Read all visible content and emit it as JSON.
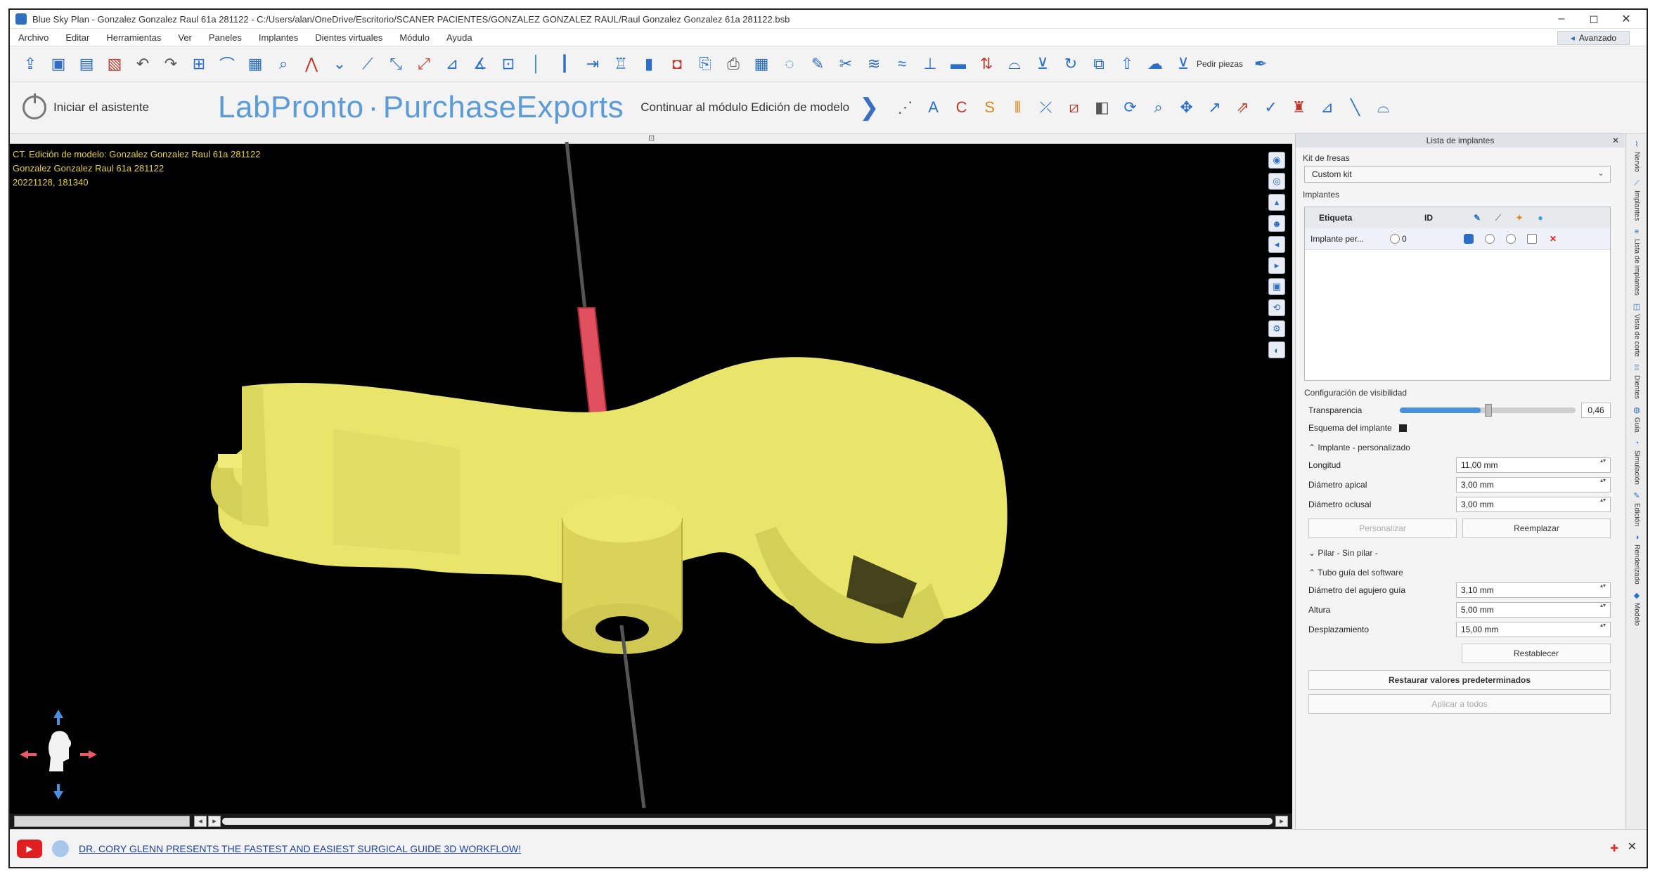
{
  "window": {
    "title": "Blue Sky Plan - Gonzalez Gonzalez Raul 61a 281122 - C:/Users/alan/OneDrive/Escritorio/SCANER PACIENTES/GONZALEZ GONZALEZ RAUL/Raul Gonzalez Gonzalez 61a 281122.bsb",
    "minimize": "–",
    "maximize": "◻",
    "close": "✕"
  },
  "menu": {
    "items": [
      "Archivo",
      "Editar",
      "Herramientas",
      "Ver",
      "Paneles",
      "Implantes",
      "Dientes virtuales",
      "Módulo",
      "Ayuda"
    ],
    "advanced": "Avanzado"
  },
  "toolbar1": {
    "order_label": "Pedir piezas"
  },
  "toolbar2": {
    "wizard": "Iniciar el asistente",
    "brand_lab": "LabPronto",
    "brand_purchase": "PurchaseExports",
    "continue": "Continuar al módulo Edición de modelo"
  },
  "viewport": {
    "line1": "CT. Edición de modelo: Gonzalez Gonzalez Raul 61a 281122",
    "line2": "Gonzalez Gonzalez Raul 61a 281122",
    "line3": "20221128, 181340",
    "colors": {
      "guide": "#e8e56a",
      "sleeve": "#d9d35a",
      "implant": "#e0505f",
      "background": "#000000"
    }
  },
  "panel": {
    "title": "Lista de implantes",
    "kit_label": "Kit de fresas",
    "kit_value": "Custom kit",
    "implants_label": "Implantes",
    "table_headers": {
      "label": "Etiqueta",
      "id": "ID"
    },
    "implant_row": {
      "label": "Implante per...",
      "id": "0"
    },
    "visibility_label": "Configuración de visibilidad",
    "transparency_label": "Transparencia",
    "transparency_value": "0,46",
    "transparency_fraction": 0.46,
    "outline_label": "Esquema del implante",
    "implant_group": "Implante - personalizado",
    "length_label": "Longitud",
    "length_value": "11,00 mm",
    "apical_label": "Diámetro apical",
    "apical_value": "3,00 mm",
    "occlusal_label": "Diámetro oclusal",
    "occlusal_value": "3,00 mm",
    "personalize_btn": "Personalizar",
    "replace_btn": "Reemplazar",
    "pilar_group": "Pilar - Sin pilar -",
    "tube_group": "Tubo guía del software",
    "hole_label": "Diámetro del agujero guía",
    "hole_value": "3,10 mm",
    "height_label": "Altura",
    "height_value": "5,00 mm",
    "offset_label": "Desplazamiento",
    "offset_value": "15,00 mm",
    "reset_btn": "Restablecer",
    "restore_btn": "Restaurar valores predeterminados",
    "apply_btn": "Aplicar a todos"
  },
  "vtabs": [
    "Nervio",
    "Implantes",
    "Lista de implantes",
    "Vista de corte",
    "Dientes",
    "Guía",
    "Simulación",
    "Edición",
    "Renderizado",
    "Modelo"
  ],
  "bottom": {
    "promo": "DR. CORY GLENN PRESENTS THE FASTEST AND EASIEST SURGICAL GUIDE 3D WORKFLOW!",
    "close": "✕"
  }
}
